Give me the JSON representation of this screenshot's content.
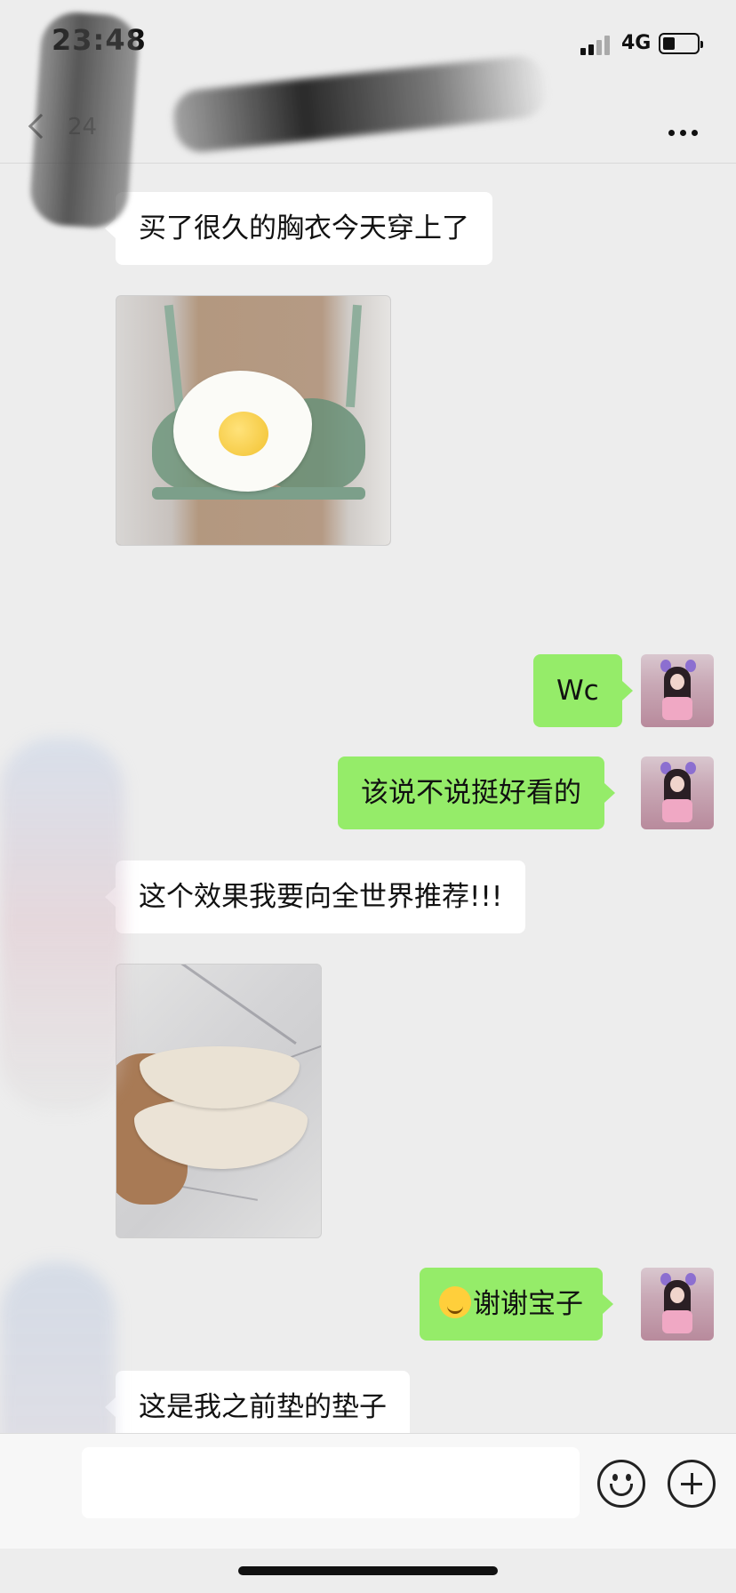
{
  "status_bar": {
    "time": "23:48",
    "network": "4G"
  },
  "nav": {
    "unread_count": "24"
  },
  "messages": [
    {
      "side": "left",
      "type": "text",
      "text": "买了很久的胸衣今天穿上了"
    },
    {
      "side": "left",
      "type": "image"
    },
    {
      "side": "right",
      "type": "text",
      "text": "Wc"
    },
    {
      "side": "right",
      "type": "text",
      "text": "该说不说挺好看的"
    },
    {
      "side": "left",
      "type": "text",
      "text": "这个效果我要向全世界推荐!!!"
    },
    {
      "side": "left",
      "type": "image"
    },
    {
      "side": "right",
      "type": "text",
      "text": "谢谢宝子",
      "emoji": "face-with-hand-over-mouth"
    },
    {
      "side": "left",
      "type": "text",
      "text": "这是我之前垫的垫子"
    }
  ],
  "composer": {
    "input_value": "",
    "emoji_icon": "emoji-icon",
    "plus_icon": "plus-icon"
  },
  "colors": {
    "background": "#ededed",
    "sent_bubble": "#95ec69",
    "received_bubble": "#ffffff"
  }
}
